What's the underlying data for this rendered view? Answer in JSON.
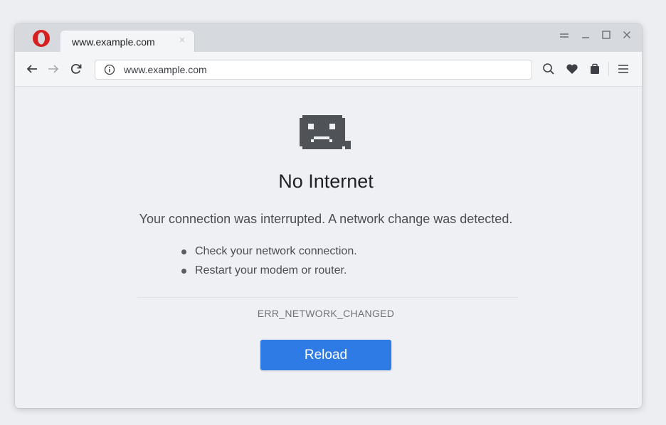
{
  "browser": {
    "tab": {
      "title": "www.example.com",
      "close_icon": "close-icon"
    },
    "window_controls": [
      "tab-menu-icon",
      "minimize-icon",
      "maximize-icon",
      "close-icon"
    ],
    "toolbar": {
      "address_text": "www.example.com",
      "icons": [
        "back-arrow-icon",
        "forward-arrow-icon",
        "reload-icon",
        "info-icon",
        "search-icon",
        "heart-icon",
        "wallet-icon",
        "menu-icon"
      ]
    },
    "brand_color": "#d6201f"
  },
  "error_page": {
    "heading": "No Internet",
    "message": "Your connection was interrupted. A network change was detected.",
    "suggestions": [
      "Check your network connection.",
      "Restart your modem or router."
    ],
    "error_code": "ERR_NETWORK_CHANGED",
    "reload_label": "Reload",
    "accent_color": "#2f7be6"
  }
}
